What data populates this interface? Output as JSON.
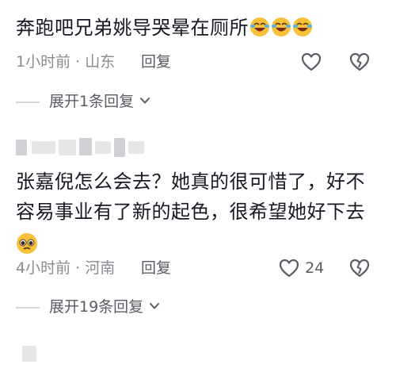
{
  "comments": [
    {
      "text": "奔跑吧兄弟姚导哭晕在厕所",
      "emojis": [
        "laugh-cry-emoji",
        "laugh-cry-emoji",
        "laugh-cry-emoji"
      ],
      "time": "1小时前",
      "separator": "·",
      "location": "山东",
      "reply_label": "回复",
      "like_count": "",
      "expand_label": "展开1条回复"
    },
    {
      "username_blurred": true,
      "text_line1": "张嘉倪怎么会去？她真的很可惜了，好不",
      "text_line2": "容易事业有了新的起色，很希望她好下去",
      "emojis": [
        "pleading-face-emoji"
      ],
      "time": "4小时前",
      "separator": "·",
      "location": "河南",
      "reply_label": "回复",
      "like_count": "24",
      "expand_label": "展开19条回复"
    }
  ],
  "colors": {
    "text": "#161823",
    "meta": "#8a8b91",
    "divider": "#d6d6da",
    "emoji_face": "#f7c23a"
  }
}
